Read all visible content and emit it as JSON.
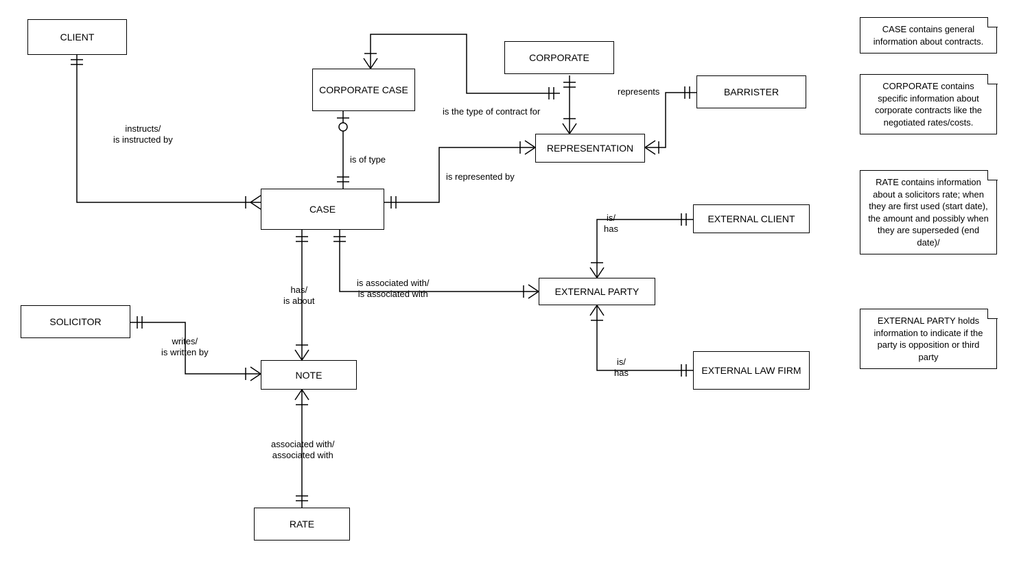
{
  "entities": {
    "client": "CLIENT",
    "corporate_case": "CORPORATE CASE",
    "corporate": "CORPORATE",
    "barrister": "BARRISTER",
    "representation": "REPRESENTATION",
    "case": "CASE",
    "external_client": "EXTERNAL CLIENT",
    "external_party": "EXTERNAL PARTY",
    "solicitor": "SOLICITOR",
    "note": "NOTE",
    "external_law_firm": "EXTERNAL LAW FIRM",
    "rate": "RATE"
  },
  "labels": {
    "instructs": "instructs/\nis instructed by",
    "is_of_type": "is of type",
    "type_contract": "is the type of contract for",
    "represented_by": "is represented by",
    "represents": "represents",
    "has_is_about": "has/\nis about",
    "associated_case_ext": "is associated with/\nis associated with",
    "is_has_ec": "is/\nhas",
    "is_has_elf": "is/\nhas",
    "writes": "writes/\nis written by",
    "assoc_rate": "associated with/\nassociated with"
  },
  "notes": {
    "n1": "CASE contains general information about contracts.",
    "n2": "CORPORATE contains specific information about corporate contracts like the negotiated rates/costs.",
    "n3": "RATE contains information about a solicitors rate; when they are first used (start date), the amount and possibly when they are superseded (end date)/",
    "n4": "EXTERNAL PARTY holds information to indicate if the party is opposition or third party"
  }
}
